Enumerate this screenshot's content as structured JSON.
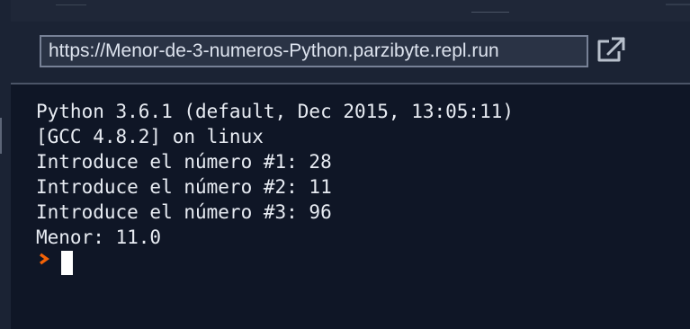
{
  "url_bar": {
    "url": "https://Menor-de-3-numeros-Python.parzibyte.repl.run",
    "open_icon": "external-link-icon"
  },
  "console": {
    "lines": [
      "Python 3.6.1 (default, Dec 2015, 13:05:11)",
      "[GCC 4.8.2] on linux",
      "Introduce el número #1: 28",
      "Introduce el número #2: 11",
      "Introduce el número #3: 96",
      "Menor: 11.0"
    ],
    "prompt_icon": "prompt-chevron-icon",
    "prompt_color": "#f26207"
  },
  "colors": {
    "background": "#0f1626",
    "chrome": "#1b2334",
    "text": "#e8ecf3"
  }
}
